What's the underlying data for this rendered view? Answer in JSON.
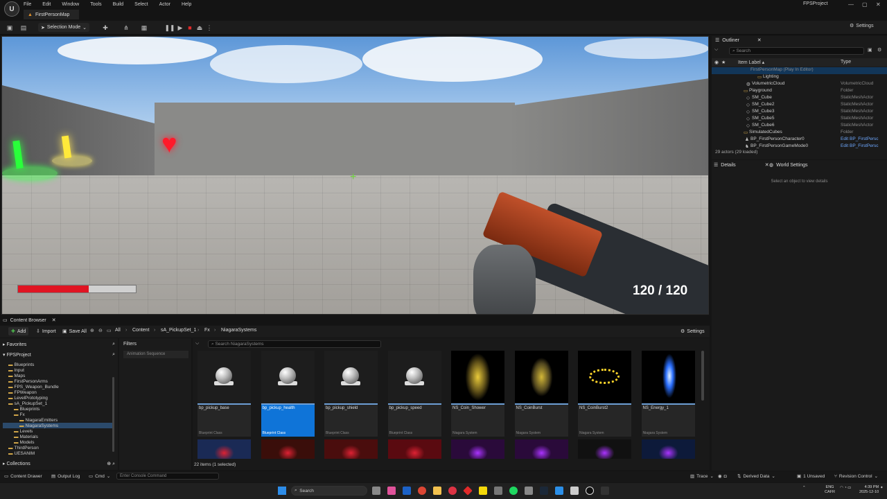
{
  "window": {
    "menu": [
      "File",
      "Edit",
      "Window",
      "Tools",
      "Build",
      "Select",
      "Actor",
      "Help"
    ],
    "map_tab": "FirstPersonMap",
    "project_name": "FPSProject",
    "controls": [
      "—",
      "▢",
      "✕"
    ]
  },
  "toolbar": {
    "mode_label": "Selection Mode",
    "settings_label": "Settings"
  },
  "viewport": {
    "health_fraction": 0.6,
    "ammo_text": "120 / 120",
    "colors": {
      "health": "#e01422",
      "pickup_green": "#29ff3a",
      "pickup_yellow": "#ffe93a",
      "heart": "#ff1a2a",
      "crosshair": "#6cd03c"
    }
  },
  "outliner": {
    "tab_label": "Outliner",
    "search_placeholder": "Search",
    "col_label": "Item Label ▴",
    "col_type": "Type",
    "rows": [
      {
        "label": "FirstPersonMap (Play In Editor)",
        "type": ""
      },
      {
        "label": "Lighting",
        "type": ""
      },
      {
        "label": "VolumetricCloud",
        "type": "VolumetricCloud"
      },
      {
        "label": "Playground",
        "type": "Folder"
      },
      {
        "label": "SM_Cube",
        "type": "StaticMeshActor"
      },
      {
        "label": "SM_Cube2",
        "type": "StaticMeshActor"
      },
      {
        "label": "SM_Cube3",
        "type": "StaticMeshActor"
      },
      {
        "label": "SM_Cube5",
        "type": "StaticMeshActor"
      },
      {
        "label": "SM_Cube6",
        "type": "StaticMeshActor"
      },
      {
        "label": "SimulatedCubes",
        "type": "Folder"
      },
      {
        "label": "BP_FirstPersonCharacter0",
        "type": "Edit BP_FirstPersc"
      },
      {
        "label": "BP_FirstPersonGameMode0",
        "type": "Edit BP_FirstPersc"
      }
    ],
    "status": "29 actors (29 loaded)"
  },
  "details": {
    "tab_details": "Details",
    "tab_world": "World Settings",
    "empty_text": "Select an object to view details"
  },
  "content_browser": {
    "tab_label": "Content Browser",
    "add_label": "Add",
    "import_label": "Import",
    "saveall_label": "Save All",
    "breadcrumb": [
      "All",
      "Content",
      "sA_PickupSet_1",
      "Fx",
      "NiagaraSystems"
    ],
    "settings_label": "Settings",
    "favorites_label": "Favorites",
    "project_label": "FPSProject",
    "tree": [
      {
        "label": "Blueprints",
        "indent": 1
      },
      {
        "label": "Input",
        "indent": 1
      },
      {
        "label": "Maps",
        "indent": 1
      },
      {
        "label": "FirstPersonArms",
        "indent": 1
      },
      {
        "label": "FPS_Weapon_Bundle",
        "indent": 1
      },
      {
        "label": "FPWeapon",
        "indent": 1
      },
      {
        "label": "LevelPrototyping",
        "indent": 1
      },
      {
        "label": "sA_PickupSet_1",
        "indent": 1
      },
      {
        "label": "Blueprints",
        "indent": 2
      },
      {
        "label": "Fx",
        "indent": 2
      },
      {
        "label": "NiagaraEmitters",
        "indent": 3
      },
      {
        "label": "NiagaraSystems",
        "indent": 3
      },
      {
        "label": "Levels",
        "indent": 2
      },
      {
        "label": "Materials",
        "indent": 2
      },
      {
        "label": "Models",
        "indent": 2
      },
      {
        "label": "ThirdPerson",
        "indent": 1
      },
      {
        "label": "UESANIM",
        "indent": 1
      }
    ],
    "collections_label": "Collections",
    "filters_label": "Filters",
    "filter_chip": "Animation Sequence",
    "search_placeholder": "Search NiagaraSystems",
    "assets": [
      {
        "name": "bp_pickup_base",
        "cls": "Blueprint Class",
        "kind": "sphere"
      },
      {
        "name": "bp_pickup_health",
        "cls": "Blueprint Class",
        "kind": "sphere"
      },
      {
        "name": "bp_pickup_shield",
        "cls": "Blueprint Class",
        "kind": "sphere"
      },
      {
        "name": "bp_pickup_speed",
        "cls": "Blueprint Class",
        "kind": "sphere"
      },
      {
        "name": "NS_Coin_Shower",
        "cls": "Niagara System",
        "kind": "shower"
      },
      {
        "name": "NS_CoinBurst",
        "cls": "Niagara System",
        "kind": "burst"
      },
      {
        "name": "NS_CoinBurst2",
        "cls": "Niagara System",
        "kind": "ring"
      },
      {
        "name": "NS_Energy_1",
        "cls": "Niagara System",
        "kind": "energy"
      }
    ],
    "status": "22 items (1 selected)"
  },
  "statusbar": {
    "content_drawer": "Content Drawer",
    "output_log": "Output Log",
    "cmd": "Cmd",
    "console_placeholder": "Enter Console Command",
    "trace": "Trace",
    "derived_data": "Derived Data",
    "unsaved": "1 Unsaved",
    "revision": "Revision Control"
  },
  "taskbar": {
    "search_placeholder": "Search",
    "lang": "ENG",
    "region": "CAFR",
    "time": "4:39 PM",
    "date": "2025-12-10"
  }
}
